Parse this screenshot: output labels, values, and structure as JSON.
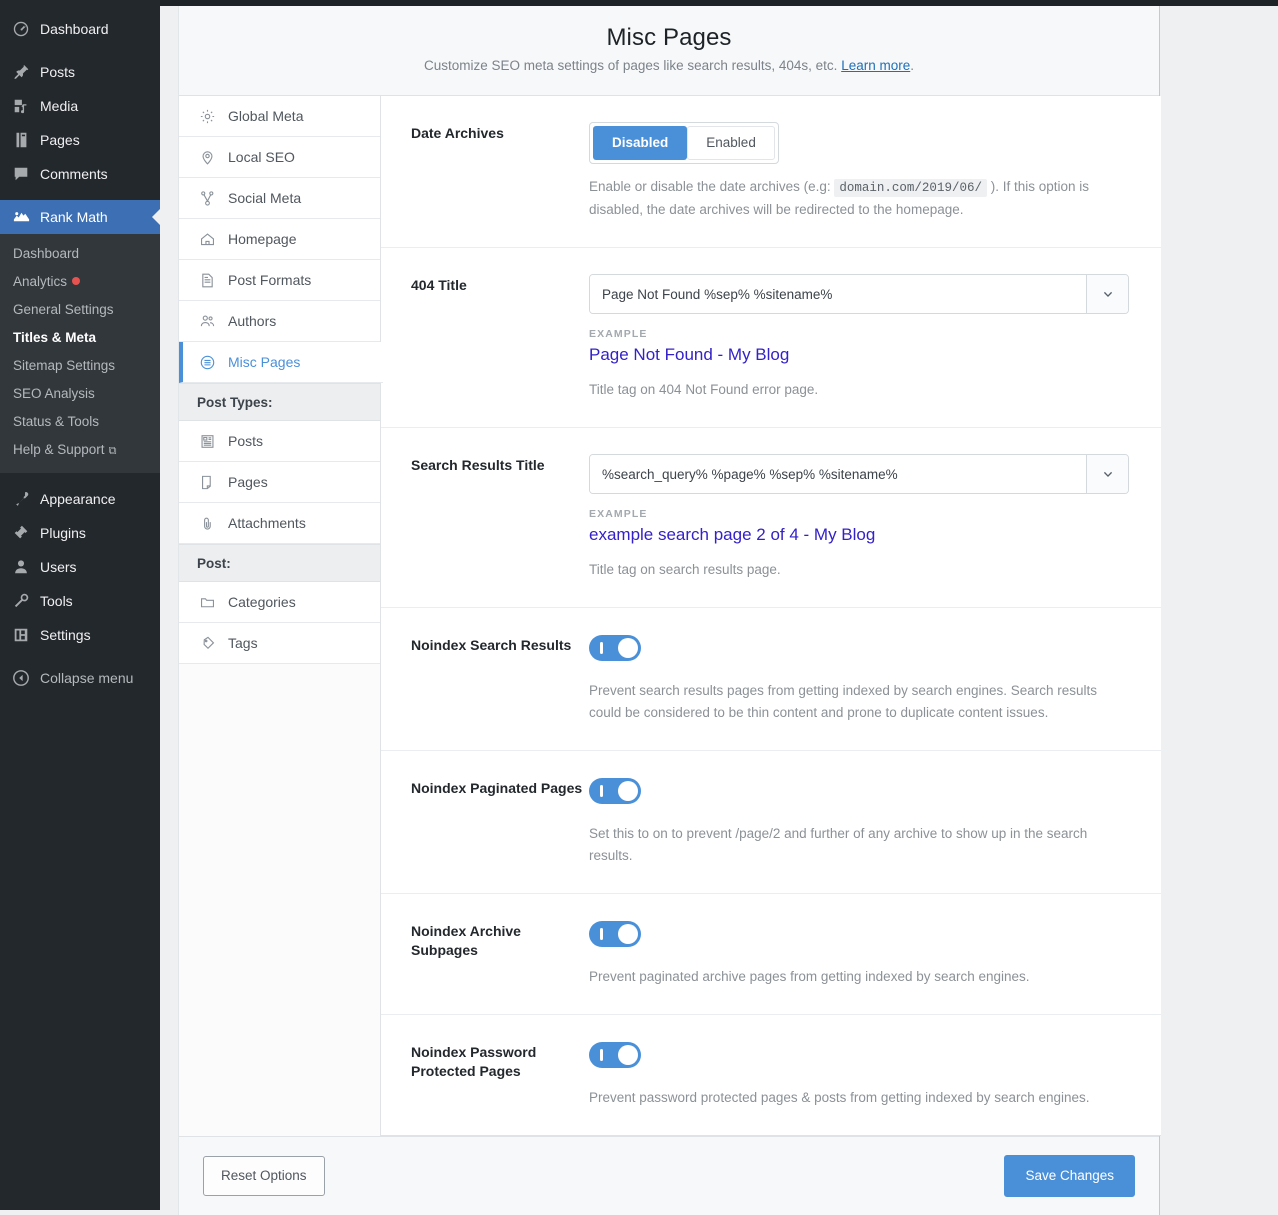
{
  "wp_sidebar": {
    "items": [
      {
        "label": "Dashboard",
        "icon": "dashboard-icon"
      },
      {
        "label": "Posts",
        "icon": "pin-icon"
      },
      {
        "label": "Media",
        "icon": "media-icon"
      },
      {
        "label": "Pages",
        "icon": "pages-icon"
      },
      {
        "label": "Comments",
        "icon": "comments-icon"
      }
    ],
    "active_item": {
      "label": "Rank Math",
      "icon": "rank-math-icon"
    },
    "submenu": [
      {
        "label": "Dashboard",
        "current": false,
        "badge": ""
      },
      {
        "label": "Analytics",
        "current": false,
        "badge": "red-dot"
      },
      {
        "label": "General Settings",
        "current": false,
        "badge": ""
      },
      {
        "label": "Titles & Meta",
        "current": true,
        "badge": ""
      },
      {
        "label": "Sitemap Settings",
        "current": false,
        "badge": ""
      },
      {
        "label": "SEO Analysis",
        "current": false,
        "badge": ""
      },
      {
        "label": "Status & Tools",
        "current": false,
        "badge": ""
      },
      {
        "label": "Help & Support",
        "current": false,
        "badge": "external-link-icon"
      }
    ],
    "items_bottom": [
      {
        "label": "Appearance",
        "icon": "appearance-icon"
      },
      {
        "label": "Plugins",
        "icon": "plugins-icon"
      },
      {
        "label": "Users",
        "icon": "users-icon"
      },
      {
        "label": "Tools",
        "icon": "tools-icon"
      },
      {
        "label": "Settings",
        "icon": "settings-icon"
      }
    ],
    "collapse": {
      "label": "Collapse menu",
      "icon": "collapse-arrow-icon"
    }
  },
  "header": {
    "title": "Misc Pages",
    "description": "Customize SEO meta settings of pages like search results, 404s, etc.",
    "learn_more": "Learn more",
    "learn_more_suffix": "."
  },
  "tabs": {
    "main": [
      {
        "label": "Global Meta",
        "icon": "gear-icon",
        "active": false
      },
      {
        "label": "Local SEO",
        "icon": "map-pin-icon",
        "active": false
      },
      {
        "label": "Social Meta",
        "icon": "share-nodes-icon",
        "active": false
      },
      {
        "label": "Homepage",
        "icon": "home-icon",
        "active": false
      },
      {
        "label": "Post Formats",
        "icon": "document-icon",
        "active": false
      },
      {
        "label": "Authors",
        "icon": "users-group-icon",
        "active": false
      },
      {
        "label": "Misc Pages",
        "icon": "list-circle-icon",
        "active": true
      }
    ],
    "group_post_types": "Post Types:",
    "post_types": [
      {
        "label": "Posts",
        "icon": "article-icon"
      },
      {
        "label": "Pages",
        "icon": "page-icon"
      },
      {
        "label": "Attachments",
        "icon": "paperclip-icon"
      }
    ],
    "group_post": "Post:",
    "taxonomies": [
      {
        "label": "Categories",
        "icon": "folder-icon"
      },
      {
        "label": "Tags",
        "icon": "tag-icon"
      }
    ]
  },
  "settings": {
    "date_archives": {
      "label": "Date Archives",
      "option_disabled": "Disabled",
      "option_enabled": "Enabled",
      "selected": "Disabled",
      "desc_before": "Enable or disable the date archives (e.g:",
      "desc_code": "domain.com/2019/06/",
      "desc_after": "). If this option is disabled, the date archives will be redirected to the homepage."
    },
    "title_404": {
      "label": "404 Title",
      "value": "Page Not Found %sep% %sitename%",
      "example_label": "EXAMPLE",
      "example_value": "Page Not Found - My Blog",
      "desc": "Title tag on 404 Not Found error page."
    },
    "search_results_title": {
      "label": "Search Results Title",
      "value": "%search_query% %page% %sep% %sitename%",
      "example_label": "EXAMPLE",
      "example_value": "example search page 2 of 4 - My Blog",
      "desc": "Title tag on search results page."
    },
    "noindex_search_results": {
      "label": "Noindex Search Results",
      "state": "on",
      "desc": "Prevent search results pages from getting indexed by search engines. Search results could be considered to be thin content and prone to duplicate content issues."
    },
    "noindex_paginated_pages": {
      "label": "Noindex Paginated Pages",
      "state": "on",
      "desc": "Set this to on to prevent /page/2 and further of any archive to show up in the search results."
    },
    "noindex_archive_subpages": {
      "label": "Noindex Archive Subpages",
      "state": "on",
      "desc": "Prevent paginated archive pages from getting indexed by search engines."
    },
    "noindex_password_protected": {
      "label": "Noindex Password Protected Pages",
      "state": "on",
      "desc": "Prevent password protected pages & posts from getting indexed by search engines."
    }
  },
  "footer": {
    "reset_label": "Reset Options",
    "save_label": "Save Changes"
  },
  "colors": {
    "accent_blue": "#4a90d9",
    "wp_sidebar_bg": "#23282d",
    "wp_submenu_bg": "#32373c",
    "example_violet": "#3421c8",
    "page_bg": "#eef0f2"
  }
}
